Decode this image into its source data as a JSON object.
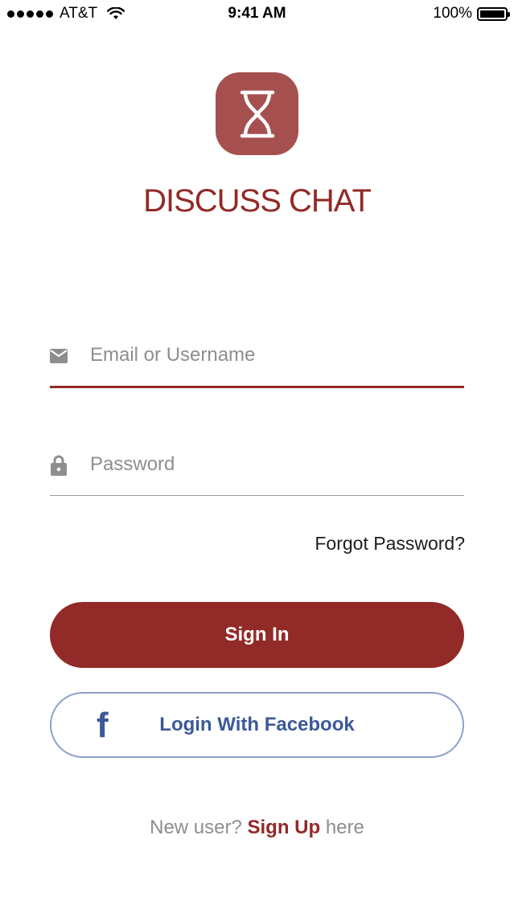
{
  "status_bar": {
    "carrier": "AT&T",
    "time": "9:41 AM",
    "battery": "100%"
  },
  "app": {
    "title": "DISCUSS CHAT",
    "brand_color": "#922a27",
    "logo_color": "#a5504f"
  },
  "form": {
    "email_placeholder": "Email or Username",
    "email_value": "",
    "password_placeholder": "Password",
    "password_value": "",
    "forgot_label": "Forgot Password?",
    "signin_label": "Sign In",
    "facebook_label": "Login With Facebook",
    "facebook_icon": "f",
    "facebook_color": "#3b5998"
  },
  "signup": {
    "prefix": "New user?",
    "link": "Sign Up",
    "suffix": "here"
  }
}
